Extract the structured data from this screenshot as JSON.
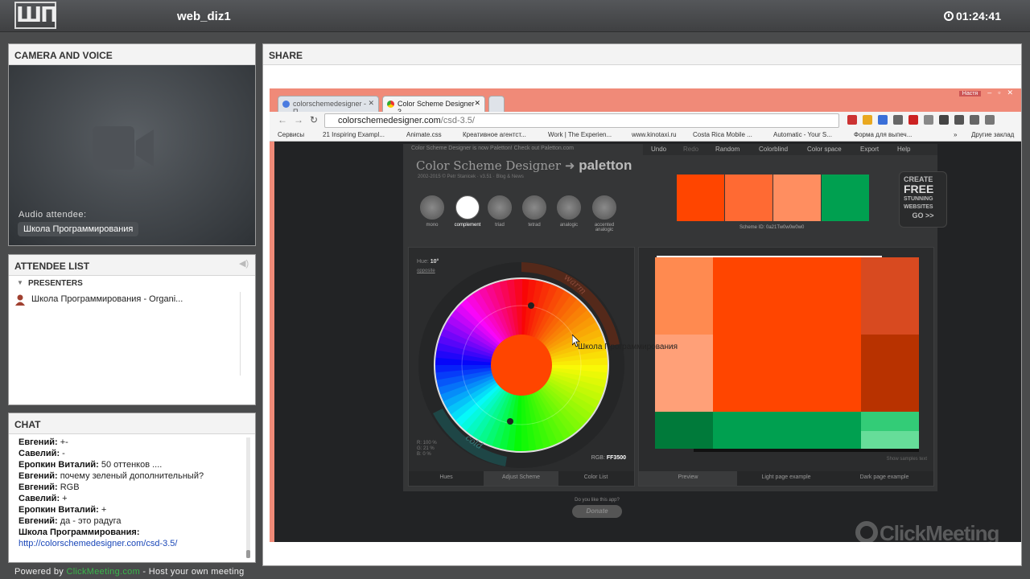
{
  "topbar": {
    "logo": "ШП",
    "room_title": "web_diz1",
    "timer": "01:24:41"
  },
  "camera": {
    "title": "CAMERA AND VOICE",
    "audio_label": "Audio attendee:",
    "audio_name": "Школа Программирования"
  },
  "attendees": {
    "title": "ATTENDEE LIST",
    "group": "PRESENTERS",
    "items": [
      {
        "name": "Школа Программирования - Organi..."
      }
    ]
  },
  "chat": {
    "title": "CHAT",
    "messages": [
      {
        "author": "Евгений:",
        "text": " +-"
      },
      {
        "author": "Савелий:",
        "text": " -"
      },
      {
        "author": "Еропкин Виталий:",
        "text": " 50 оттенков ...."
      },
      {
        "author": "Евгений:",
        "text": " почему зеленый дополнительный?"
      },
      {
        "author": "Евгений:",
        "text": " RGB"
      },
      {
        "author": "Савелий:",
        "text": " +"
      },
      {
        "author": "Еропкин Виталий:",
        "text": " +"
      },
      {
        "author": "Евгений:",
        "text": " да - это радуга"
      },
      {
        "author": "Школа Программирования:",
        "text": ""
      }
    ],
    "link": "http://colorschemedesigner.com/csd-3.5/"
  },
  "footer": {
    "prefix": "Powered by ",
    "brand": "ClickMeeting.com",
    "suffix": " - Host your own meeting"
  },
  "share": {
    "title": "SHARE",
    "browser": {
      "tabs": [
        {
          "label": "colorschemedesigner - П"
        },
        {
          "label": "Color Scheme Designer 3"
        }
      ],
      "user": "Настя",
      "url_host": "colorschemedesigner.com",
      "url_path": "/csd-3.5/",
      "bookmarks": [
        "Сервисы",
        "21 Inspiring Exampl...",
        "Animate.css",
        "Креативное агентст...",
        "Work | The Experien...",
        "www.kinotaxi.ru",
        "Costa Rica Mobile ...",
        "Automatic - Your S...",
        "Форма для выпеч...",
        "»",
        "Другие заклад"
      ]
    },
    "csd": {
      "notice": "Color Scheme Designer is now Paletton! Check out Paletton.com",
      "menu": [
        "Undo",
        "Redo",
        "Random",
        "Colorblind",
        "Color space",
        "Export",
        "Help"
      ],
      "title": "Color Scheme Designer",
      "arrow": "➜",
      "brand": "paletton",
      "sub": "2002-2015 © Petr Stanicek · v3.51 · Blog & News",
      "schemes": [
        "mono",
        "complement",
        "triad",
        "tetrad",
        "analogic",
        "accented analogic"
      ],
      "swatches": [
        "#ff4500",
        "#ff6a33",
        "#ff8e60",
        "#00a050"
      ],
      "scheme_id": "Scheme ID: 0a21Tw0w0w0w0",
      "ad": [
        "CREATE",
        "FREE",
        "STUNNING",
        "WEBSITES",
        "GO >>"
      ],
      "hue_label": "Hue:",
      "hue_value": "10°",
      "opposite": "opposite",
      "warm": "warm",
      "cold": "cold",
      "rgb_lines": [
        "R: 100 %",
        "G:  21 %",
        "B:   0 %"
      ],
      "rgb_label": "RGB:",
      "rgb_hex": "FF3500",
      "left_tabs": [
        "Hues",
        "Adjust Scheme",
        "Color List"
      ],
      "right_tabs": [
        "Preview",
        "Light page example",
        "Dark page example"
      ],
      "show_samples": "Show samples text",
      "donate_q": "Do you like this app?",
      "donate": "Donate"
    },
    "overlay_text": "Школа Программирования",
    "watermark": "ClickMeeting"
  },
  "colors": {
    "main": "#ff4500",
    "dark1": "#b83200",
    "dark2": "#d84a20",
    "light1": "#ff8a50",
    "light2": "#ffa078",
    "green": "#00a050",
    "green_dark": "#007a3a",
    "green_light": "#33cc77",
    "green_pale": "#66dd99"
  }
}
